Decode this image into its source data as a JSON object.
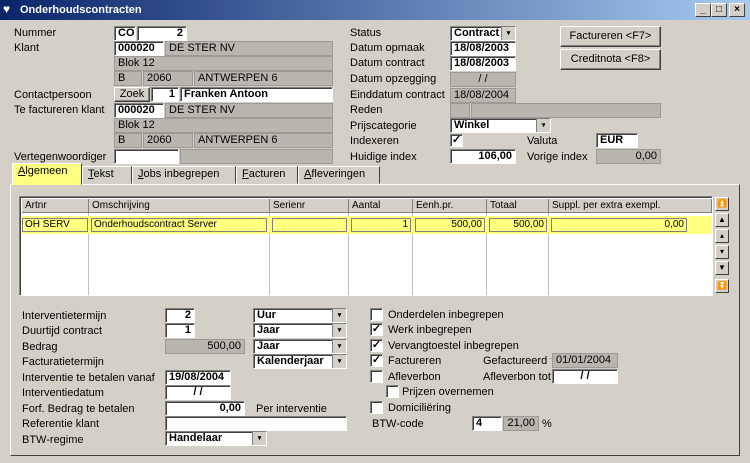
{
  "window": {
    "title": "Onderhoudscontracten"
  },
  "header": {
    "nummer_label": "Nummer",
    "nummer_prefix": "CO",
    "nummer_value": "2",
    "klant_label": "Klant",
    "klant_code": "000020",
    "klant_name": "DE STER NV",
    "klant_street": "Blok 12",
    "klant_country": "B",
    "klant_zip": "2060",
    "klant_city": "ANTWERPEN 6",
    "contact_label": "Contactpersoon",
    "contact_search": "Zoek",
    "contact_nr": "1",
    "contact_name": "Franken Antoon",
    "tfk_label": "Te factureren klant",
    "tfk_code": "000020",
    "tfk_name": "DE STER NV",
    "tfk_street": "Blok 12",
    "tfk_country": "B",
    "tfk_zip": "2060",
    "tfk_city": "ANTWERPEN 6",
    "rep_label": "Vertegenwoordiger"
  },
  "status": {
    "status_label": "Status",
    "status_value": "Contract",
    "opmaak_label": "Datum opmaak",
    "opmaak_value": "18/08/2003",
    "contract_label": "Datum contract",
    "contract_value": "18/08/2003",
    "opzegging_label": "Datum opzegging",
    "opzegging_value": "/   /",
    "einddatum_label": "Einddatum contract",
    "einddatum_value": "18/08/2004",
    "reden_label": "Reden",
    "prijscat_label": "Prijscategorie",
    "prijscat_value": "Winkel",
    "indexeren_label": "Indexeren",
    "indexeren_checked": true,
    "valuta_label": "Valuta",
    "valuta_value": "EUR",
    "index_label": "Huidige index",
    "index_value": "106,00",
    "vorige_label": "Vorige index",
    "vorige_value": "0,00"
  },
  "buttons": {
    "factureren": "Factureren <F7>",
    "creditnota": "Creditnota <F8>"
  },
  "tabs": [
    {
      "label": "Algemeen"
    },
    {
      "label": "Tekst"
    },
    {
      "label": "Jobs inbegrepen"
    },
    {
      "label": "Facturen"
    },
    {
      "label": "Afleveringen"
    }
  ],
  "grid": {
    "columns": [
      "Artnr",
      "Omschrijving",
      "Serienr",
      "Aantal",
      "Eenh.pr.",
      "Totaal",
      "Suppl. per extra exempl."
    ],
    "rows": [
      [
        "OH SERV",
        "Onderhoudscontract Server",
        "",
        "1",
        "500,00",
        "500,00",
        "0,00"
      ]
    ]
  },
  "details": {
    "interventietermijn_label": "Interventietermijn",
    "interventietermijn_value": "2",
    "interventietermijn_unit": "Uur",
    "duurtijd_label": "Duurtijd contract",
    "duurtijd_value": "1",
    "duurtijd_unit": "Jaar",
    "bedrag_label": "Bedrag",
    "bedrag_value": "500,00",
    "bedrag_unit": "Jaar",
    "factuurtermijn_label": "Facturatietermijn",
    "factuurtermijn_value": "Kalenderjaar",
    "vanaf_label": "Interventie te betalen vanaf",
    "vanaf_value": "19/08/2004",
    "interventiedatum_label": "Interventiedatum",
    "interventiedatum_value": "/   /",
    "forf_label": "Forf. Bedrag te betalen",
    "forf_value": "0,00",
    "forf_unit": "Per interventie",
    "ref_label": "Referentie klant",
    "btw_label": "BTW-regime",
    "btw_value": "Handelaar"
  },
  "options": {
    "onderdelen": {
      "label": "Onderdelen inbegrepen",
      "checked": false
    },
    "werk": {
      "label": "Werk inbegrepen",
      "checked": true
    },
    "vervang": {
      "label": "Vervangtoestel inbegrepen",
      "checked": true
    },
    "factureren": {
      "label": "Factureren",
      "checked": true
    },
    "afleverbon": {
      "label": "Afleverbon",
      "checked": false
    },
    "prijzen": {
      "label": "Prijzen overnemen",
      "checked": false
    },
    "domicil": {
      "label": "Domiciliëring",
      "checked": false
    },
    "gefactureerd_label": "Gefactureerd t",
    "gefactureerd_value": "01/01/2004",
    "afleverbon_tot_label": "Afleverbon tot",
    "afleverbon_tot_value": "/   /",
    "btwcode_label": "BTW-code",
    "btwcode_value": "4",
    "btwcode_pct": "21,00",
    "pct_sign": "%"
  },
  "icons": {
    "check": "✓",
    "dropdown": "▾"
  }
}
